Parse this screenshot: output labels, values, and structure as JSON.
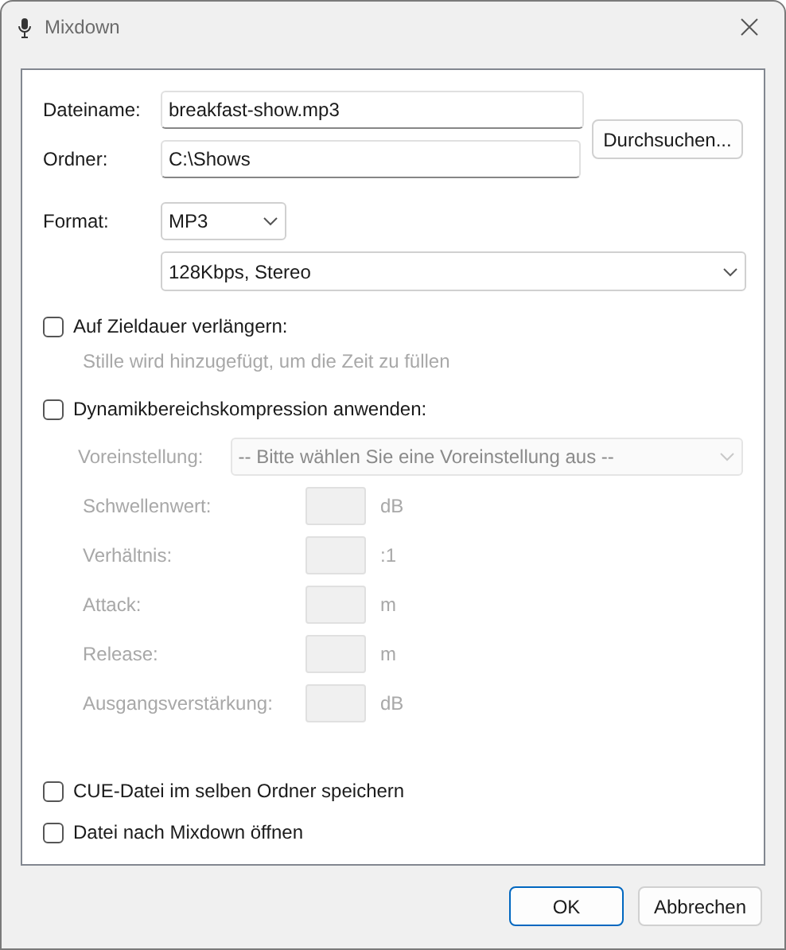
{
  "window": {
    "title": "Mixdown"
  },
  "file_fields": [
    {
      "label": "Dateiname:",
      "value": "breakfast-show.mp3"
    },
    {
      "label": "Ordner:",
      "value": "C:\\Shows"
    }
  ],
  "browse_button": "Durchsuchen...",
  "format": {
    "label": "Format:",
    "value": "MP3",
    "quality": "128Kbps, Stereo"
  },
  "extend": {
    "label": "Auf Zieldauer verlängern:",
    "checked": false,
    "hint": "Stille wird hinzugefügt, um die Zeit zu füllen"
  },
  "compression": {
    "label": "Dynamikbereichskompression anwenden:",
    "checked": false,
    "disabled": true,
    "preset_label": "Voreinstellung:",
    "preset_value": "-- Bitte wählen Sie eine Voreinstellung aus --",
    "params": [
      {
        "label": "Schwellenwert:",
        "unit": "dB"
      },
      {
        "label": "Verhältnis:",
        "unit": ":1"
      },
      {
        "label": "Attack:",
        "unit": "m"
      },
      {
        "label": "Release:",
        "unit": "m"
      },
      {
        "label": "Ausgangsverstärkung:",
        "unit": "dB"
      }
    ]
  },
  "options": [
    {
      "label": "CUE-Datei im selben Ordner speichern",
      "checked": false
    },
    {
      "label": "Datei nach Mixdown öffnen",
      "checked": false
    }
  ],
  "buttons": [
    {
      "label": "OK",
      "kind": "default"
    },
    {
      "label": "Abbrechen",
      "kind": "normal"
    }
  ]
}
